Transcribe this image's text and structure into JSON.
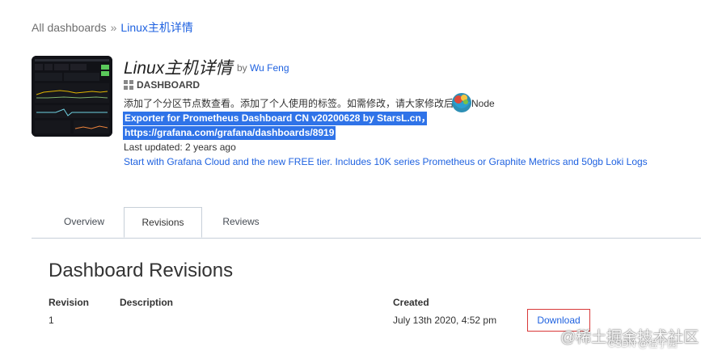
{
  "breadcrumb": {
    "root": "All dashboards",
    "separator": "»",
    "current": "Linux主机详情"
  },
  "dashboard": {
    "title": "Linux主机详情",
    "by_prefix": "by",
    "author": "Wu Feng",
    "type_label": "DASHBOARD",
    "description": "添加了个分区节点数查看。添加了个人使用的标签。如需修改，请大家修改后：1 Node",
    "selected_line1": "Exporter for Prometheus Dashboard CN v20200628 by StarsL.cn，",
    "selected_line2": "https://grafana.com/grafana/dashboards/8919",
    "last_updated": "Last updated: 2 years ago",
    "promo": "Start with Grafana Cloud and the new FREE tier. Includes 10K series Prometheus or Graphite Metrics and 50gb Loki Logs"
  },
  "tabs": [
    {
      "label": "Overview",
      "active": false
    },
    {
      "label": "Revisions",
      "active": true
    },
    {
      "label": "Reviews",
      "active": false
    }
  ],
  "revisions": {
    "heading": "Dashboard Revisions",
    "columns": {
      "revision": "Revision",
      "description": "Description",
      "created": "Created"
    },
    "rows": [
      {
        "revision": "1",
        "description": "",
        "created": "July 13th 2020, 4:52 pm",
        "action": "Download"
      }
    ]
  },
  "watermark": {
    "line1": "@稀土掘金技术社区",
    "line2": "CSDN @橙子园"
  },
  "colors": {
    "link": "#1f62e0",
    "selection": "#2f73e8",
    "highlight_box": "#d83838",
    "thumbnail_bg": "#111217"
  }
}
